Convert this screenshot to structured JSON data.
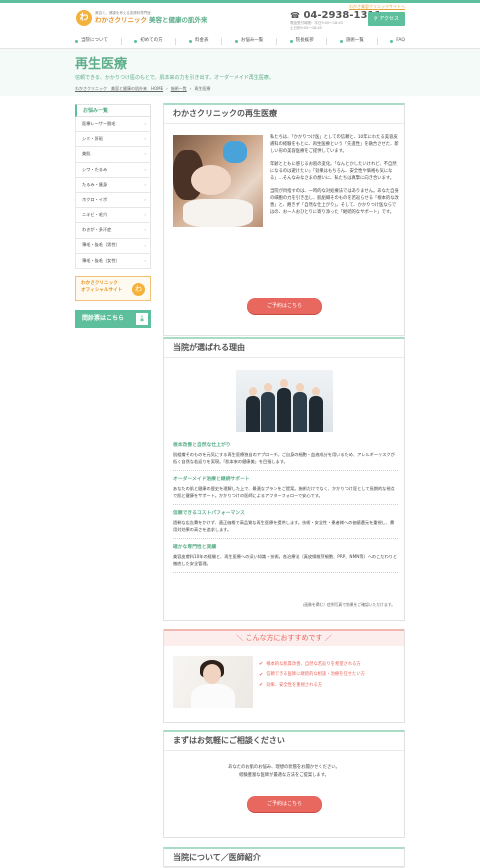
{
  "header": {
    "top_link": "わかさ美容クリニックサイトへ",
    "logo_mark": "わ",
    "logo_tag": "美容と、健康を考える皮膚科専門医",
    "logo_name": "わかさクリニック",
    "logo_sub": "美容と健康の肌外来",
    "phone": "04-2938-1311",
    "hours_1": "電話受付時間：平日9:00～18:45",
    "hours_2": "土日祝9:00～18:45",
    "access": "アクセス"
  },
  "nav": {
    "items": [
      "当院について",
      "初めての方",
      "料金表",
      "お悩み一覧",
      "院長挨拶",
      "施術一覧",
      "FAQ"
    ]
  },
  "hero": {
    "title": "再生医療",
    "lead": "信頼できる、かかりつけ医のもとで。肌本来の力を引き出す、オーダーメイド再生医療。",
    "breadcrumb": [
      "わかさクリニック　美容と健康の肌外来　HOME",
      "施術一覧",
      "再生医療"
    ]
  },
  "sidebar": {
    "head": "お悩み一覧",
    "items": [
      "医療レーザー脱毛",
      "シミ・肝斑",
      "美肌",
      "シワ・たるみ",
      "たるみ・痩身",
      "ホクロ・イボ",
      "ニキビ・毛穴",
      "わきが・多汗症",
      "薄毛・抜毛（男性）",
      "薄毛・抜毛（女性）"
    ],
    "banner_1": "わかさクリニック",
    "banner_2": "オフィシャルサイト",
    "banner_mark": "わ",
    "form_btn": "問診票はこちら"
  },
  "card1": {
    "title": "わかさクリニックの再生医療",
    "p1": "私たちは、「かかりつけ医」としての信頼と、10年にわたる美容皮膚科の経験をもとに、再生医療という「先進性」を融合させた、新しい形の美容医療をご提供しています。",
    "p2": "年齢とともに感じるお肌の変化。「なんとかしたいけれど、不自然になるのは避けたい」「効果はもちろん、安全性や価格も気になる」…そんなみなさまの想いに、私たちは真摯に向き合います。",
    "p3": "当院が目指すのは、一時的な対処療法ではありません。あなた自身の細胞の力を引き出し、肌組織そのものを若返らせる「根本的な改善」と、飽きず「自然な仕上がり」。そして、かかりつけ医ならではの、お一人おひとりに寄り添った「継続的なサポート」です。",
    "btn": "ご予約はこちら"
  },
  "card2": {
    "title": "当院が選ばれる理由",
    "reasons": [
      {
        "h": "根本改善と自然な仕上がり",
        "b": "肌組織そのものを元気にする再生医療独自のアプローチ。ご自身の細胞・血液成分を用いるため、アレルギーリスクが低く自然な若返りを実現。「肌本来の健康美」を目指します。"
      },
      {
        "h": "オーダーメイド治療と継続サポート",
        "b": "あなたの肌と健康の歴史を理解した上で、最適なプランをご提案。施術だけでなく、かかりつけ医として長期的な視点で肌と健康をサポート。かかりつけの医師によるアフターフォローで安心です。"
      },
      {
        "h": "信頼できるコストパフォーマンス",
        "b": "過剰な広告費をかけず、適正価格で高品質な再生医療を提供します。技術・安全性・患者様への価値還元を重視し、費用対効果の高さを追求します。"
      },
      {
        "h": "確かな専門性と実績",
        "b": "美容皮膚科10年の経験と、再生医療への深い知識・技術。各治療法（真皮線維芽細胞、PRP、NMN等）へのこだわりと徹底した安全管理。"
      }
    ],
    "note": "(画像を掲む）症例写真で効果をご確認いただけます。"
  },
  "card3": {
    "title": "こんな方におすすめです",
    "items": [
      "根本的な肌質改善、自然な若返りを希望される方",
      "信頼できる医師に継続的な相談・治療を任せたい方",
      "効果、安全性を重視される方"
    ]
  },
  "card4": {
    "title": "まずはお気軽にご相談ください",
    "line1": "あなたのお肌のお悩み、理想の状態をお聞かせください。",
    "line2": "経験豊富な医師が最適な方法をご提案します。",
    "btn": "ご予約はこちら"
  },
  "card5": {
    "title": "当院について／医師紹介"
  },
  "colors": {
    "accent_green": "#5dbf9b",
    "accent_orange": "#e89427",
    "accent_red": "#e8675e"
  }
}
